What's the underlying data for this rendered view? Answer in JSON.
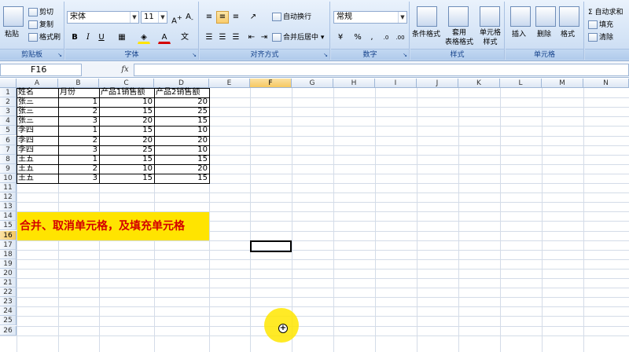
{
  "ribbon": {
    "clipboard": {
      "paste": "粘贴",
      "cut": "剪切",
      "copy": "复制",
      "format_painter": "格式刷",
      "label": "剪贴板"
    },
    "font": {
      "name": "宋体",
      "size": "11",
      "bold": "B",
      "italic": "I",
      "underline": "U",
      "label": "字体"
    },
    "alignment": {
      "wrap_text": "自动换行",
      "merge_center": "合并后居中",
      "label": "对齐方式"
    },
    "number": {
      "format": "常规",
      "percent": "%",
      "comma": ",",
      "label": "数字"
    },
    "styles": {
      "conditional": "条件格式",
      "table_format": "套用\n表格格式",
      "cell_styles": "单元格\n样式",
      "label": "样式"
    },
    "cells": {
      "insert": "插入",
      "delete": "删除",
      "format": "格式",
      "label": "单元格"
    },
    "editing": {
      "autosum": "Σ 自动求和",
      "fill": "填充",
      "clear": "清除"
    }
  },
  "formula_bar": {
    "name_box": "F16",
    "fx": "fx",
    "value": ""
  },
  "columns": [
    "A",
    "B",
    "C",
    "D",
    "E",
    "F",
    "G",
    "H",
    "I",
    "J",
    "K",
    "L",
    "M",
    "N"
  ],
  "active_col": "F",
  "rows": [
    "1",
    "2",
    "3",
    "4",
    "5",
    "6",
    "7",
    "8",
    "9",
    "10",
    "11",
    "12",
    "13",
    "14",
    "15",
    "16",
    "17",
    "18",
    "19",
    "20",
    "21",
    "22",
    "23",
    "24",
    "25",
    "26"
  ],
  "active_row": "16",
  "table": {
    "headers": [
      "姓名",
      "月份",
      "产品1销售额",
      "产品2销售额"
    ],
    "rows": [
      [
        "张三",
        "1",
        "10",
        "20"
      ],
      [
        "张三",
        "2",
        "15",
        "25"
      ],
      [
        "张三",
        "3",
        "20",
        "15"
      ],
      [
        "李四",
        "1",
        "15",
        "10"
      ],
      [
        "李四",
        "2",
        "20",
        "20"
      ],
      [
        "李四",
        "3",
        "25",
        "10"
      ],
      [
        "王五",
        "1",
        "15",
        "15"
      ],
      [
        "王五",
        "2",
        "10",
        "20"
      ],
      [
        "王五",
        "3",
        "15",
        "15"
      ]
    ]
  },
  "banner_text": "合并、取消单元格，及填充单元格",
  "colors": {
    "banner_bg": "#ffe400",
    "banner_text": "#d40000",
    "highlight": "#ffe600"
  }
}
